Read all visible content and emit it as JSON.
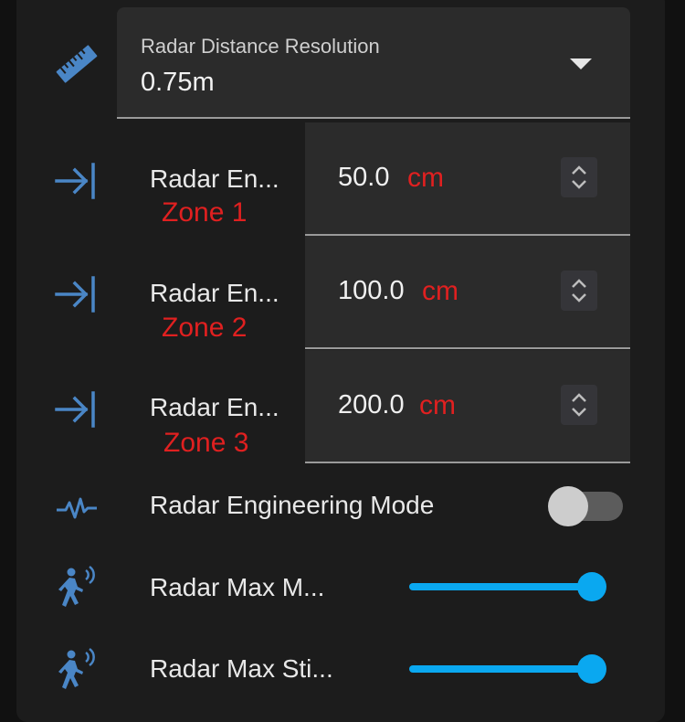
{
  "colors": {
    "accent": "#0aa8f0",
    "icon_blue": "#4a86c6",
    "unit_red": "#e02020",
    "card_bg": "#1c1c1c",
    "field_bg": "#2b2b2b"
  },
  "resolution": {
    "icon": "ruler-icon",
    "label": "Radar Distance Resolution",
    "value": "0.75m"
  },
  "zones": [
    {
      "icon": "arrow-to-line-icon",
      "label": "Radar En...",
      "zone": "Zone 1",
      "value": "50.0",
      "unit": "cm"
    },
    {
      "icon": "arrow-to-line-icon",
      "label": "Radar En...",
      "zone": "Zone 2",
      "value": "100.0",
      "unit": "cm"
    },
    {
      "icon": "arrow-to-line-icon",
      "label": "Radar En...",
      "zone": "Zone 3",
      "value": "200.0",
      "unit": "cm"
    }
  ],
  "engineering_mode": {
    "icon": "pulse-icon",
    "label": "Radar Engineering Mode",
    "on": false
  },
  "sliders": [
    {
      "icon": "walking-person-signal-icon",
      "label": "Radar Max M...",
      "level": 1.0
    },
    {
      "icon": "walking-person-signal-icon",
      "label": "Radar Max Sti...",
      "level": 1.0
    }
  ]
}
